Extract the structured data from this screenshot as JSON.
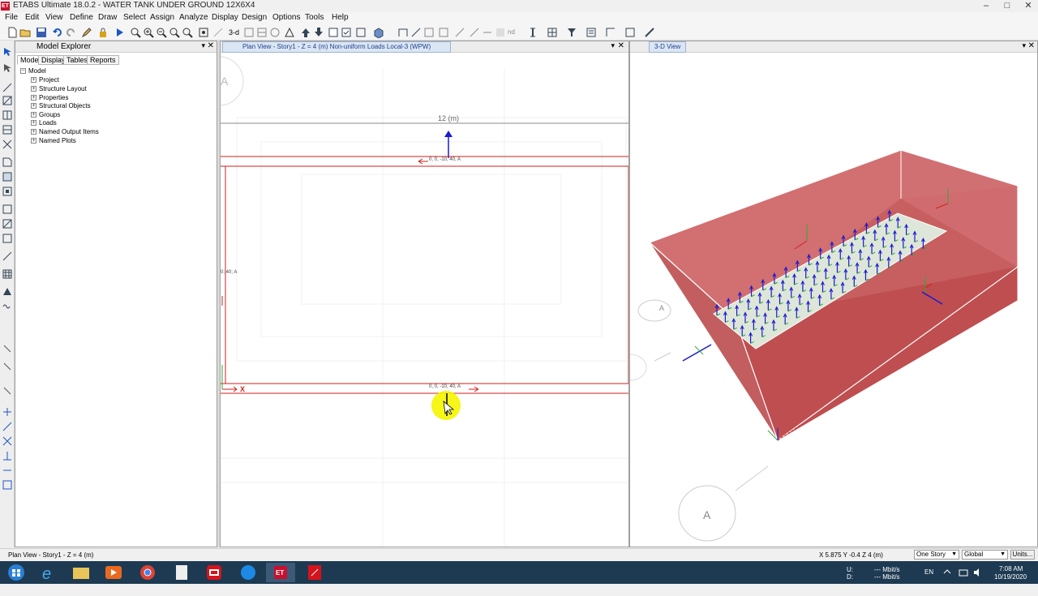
{
  "window": {
    "title": "ETABS Ultimate 18.0.2 - WATER TANK UNDER GROUND 12X6X4",
    "icon_text": "ET"
  },
  "menu": [
    "File",
    "Edit",
    "View",
    "Define",
    "Draw",
    "Select",
    "Assign",
    "Analyze",
    "Display",
    "Design",
    "Options",
    "Tools",
    "Help"
  ],
  "toolbar": {
    "view_3d_label": "3-d",
    "nd_label": "nd"
  },
  "explorer": {
    "title": "Model Explorer",
    "tabs": [
      "Model",
      "Display",
      "Tables",
      "Reports"
    ],
    "root": "Model",
    "items": [
      "Project",
      "Structure Layout",
      "Properties",
      "Structural Objects",
      "Groups",
      "Loads",
      "Named Output Items",
      "Named Plots"
    ]
  },
  "plan_view": {
    "title": "Plan View - Story1 - Z = 4 (m)  Non-uniform Loads Local-3  (WPW)",
    "dimension_label": "12 (m)",
    "load_label_top": "0, 0, -10, 40, A",
    "load_label_bottom": "0, 0, -10, 40, A",
    "load_label_left": "0; 40; A",
    "axis_x_label": "X",
    "grid_bubble_label": "A"
  },
  "view_3d": {
    "title": "3-D View",
    "grid_bubble_label": "A"
  },
  "status": {
    "left_text": "Plan View - Story1 - Z = 4 (m)",
    "coords": "X 5.875  Y -0.4  Z 4 (m)",
    "story_select": "One Story",
    "coord_select": "Global",
    "units_button": "Units..."
  },
  "taskbar": {
    "network_up": "--- Mbit/s",
    "network_down": "--- Mbit/s",
    "net_up_label": "U:",
    "net_down_label": "D:",
    "language": "EN",
    "time": "7:08 AM",
    "date": "10/19/2020"
  },
  "colors": {
    "load_red": "#d01f1f",
    "arrow_blue": "#1a1ad0",
    "arrow_green": "#2eaa2e",
    "tank_fill": "#c8575a",
    "taskbar": "#1d3a52"
  }
}
